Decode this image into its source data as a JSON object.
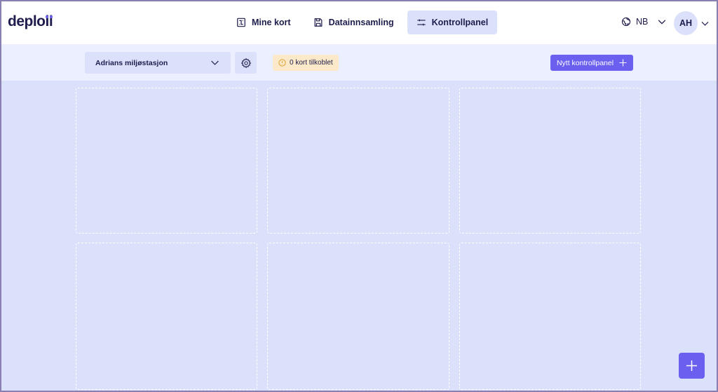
{
  "app": {
    "logo_text": "deploii"
  },
  "nav": {
    "items": [
      {
        "label": "Mine kort",
        "icon": "circuit-board-icon",
        "active": false
      },
      {
        "label": "Datainnsamling",
        "icon": "floppy-disk-icon",
        "active": false
      },
      {
        "label": "Kontrollpanel",
        "icon": "sliders-icon",
        "active": true
      }
    ]
  },
  "language": {
    "label": "NB",
    "icon": "globe-icon"
  },
  "user": {
    "initials": "AH"
  },
  "toolbar": {
    "station_select_value": "Adrians miljøstasjon",
    "status_text": "0 kort tilkoblet",
    "new_dashboard_label": "Nytt kontrollpanel"
  },
  "colors": {
    "accent": "#6b5ff0",
    "background": "#dbe0fb",
    "subbar": "#ecefff",
    "warning_badge": "#fbe9c9",
    "text": "#1f1d4d"
  }
}
